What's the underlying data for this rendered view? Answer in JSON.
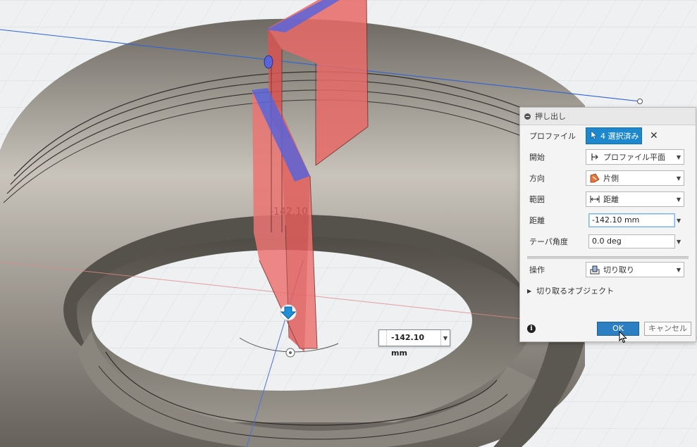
{
  "viewport": {
    "dimension_ghost_text": "-142.10",
    "floating_dimension_value": "-142.10 mm"
  },
  "dialog": {
    "title": "押し出し",
    "profile": {
      "label": "プロファイル",
      "selection": "4 選択済み"
    },
    "start": {
      "label": "開始",
      "value": "プロファイル平面"
    },
    "direction": {
      "label": "方向",
      "value": "片側"
    },
    "extent": {
      "label": "範囲",
      "value": "距離"
    },
    "distance": {
      "label": "距離",
      "value": "-142.10 mm"
    },
    "taper": {
      "label": "テーパ角度",
      "value": "0.0 deg"
    },
    "operation": {
      "label": "操作",
      "value": "切り取り"
    },
    "objects_to_cut": {
      "label": "切り取るオブジェクト"
    },
    "ok_label": "OK",
    "cancel_label": "キャンセル"
  },
  "colors": {
    "accent": "#1e88cf",
    "cut_body": "#e8504f",
    "selected_face": "#5a64d8"
  }
}
